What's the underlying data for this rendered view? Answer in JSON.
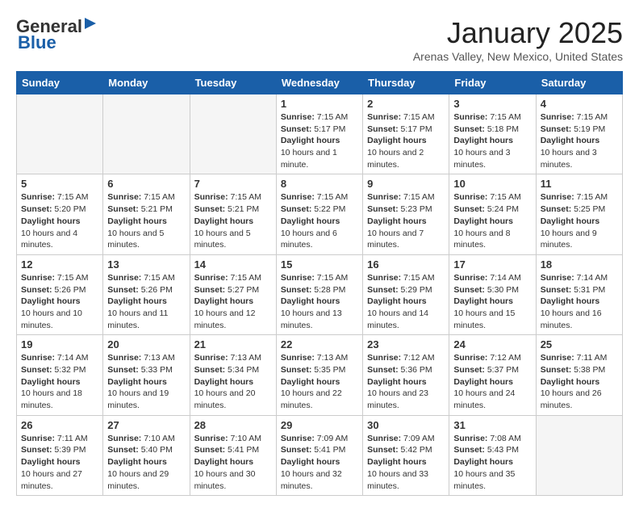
{
  "header": {
    "logo_line1": "General",
    "logo_line2": "Blue",
    "month": "January 2025",
    "location": "Arenas Valley, New Mexico, United States"
  },
  "weekdays": [
    "Sunday",
    "Monday",
    "Tuesday",
    "Wednesday",
    "Thursday",
    "Friday",
    "Saturday"
  ],
  "weeks": [
    [
      {
        "day": "",
        "empty": true
      },
      {
        "day": "",
        "empty": true
      },
      {
        "day": "",
        "empty": true
      },
      {
        "day": "1",
        "sunrise": "7:15 AM",
        "sunset": "5:17 PM",
        "daylight": "10 hours and 1 minute."
      },
      {
        "day": "2",
        "sunrise": "7:15 AM",
        "sunset": "5:17 PM",
        "daylight": "10 hours and 2 minutes."
      },
      {
        "day": "3",
        "sunrise": "7:15 AM",
        "sunset": "5:18 PM",
        "daylight": "10 hours and 3 minutes."
      },
      {
        "day": "4",
        "sunrise": "7:15 AM",
        "sunset": "5:19 PM",
        "daylight": "10 hours and 3 minutes."
      }
    ],
    [
      {
        "day": "5",
        "sunrise": "7:15 AM",
        "sunset": "5:20 PM",
        "daylight": "10 hours and 4 minutes."
      },
      {
        "day": "6",
        "sunrise": "7:15 AM",
        "sunset": "5:21 PM",
        "daylight": "10 hours and 5 minutes."
      },
      {
        "day": "7",
        "sunrise": "7:15 AM",
        "sunset": "5:21 PM",
        "daylight": "10 hours and 5 minutes."
      },
      {
        "day": "8",
        "sunrise": "7:15 AM",
        "sunset": "5:22 PM",
        "daylight": "10 hours and 6 minutes."
      },
      {
        "day": "9",
        "sunrise": "7:15 AM",
        "sunset": "5:23 PM",
        "daylight": "10 hours and 7 minutes."
      },
      {
        "day": "10",
        "sunrise": "7:15 AM",
        "sunset": "5:24 PM",
        "daylight": "10 hours and 8 minutes."
      },
      {
        "day": "11",
        "sunrise": "7:15 AM",
        "sunset": "5:25 PM",
        "daylight": "10 hours and 9 minutes."
      }
    ],
    [
      {
        "day": "12",
        "sunrise": "7:15 AM",
        "sunset": "5:26 PM",
        "daylight": "10 hours and 10 minutes."
      },
      {
        "day": "13",
        "sunrise": "7:15 AM",
        "sunset": "5:26 PM",
        "daylight": "10 hours and 11 minutes."
      },
      {
        "day": "14",
        "sunrise": "7:15 AM",
        "sunset": "5:27 PM",
        "daylight": "10 hours and 12 minutes."
      },
      {
        "day": "15",
        "sunrise": "7:15 AM",
        "sunset": "5:28 PM",
        "daylight": "10 hours and 13 minutes."
      },
      {
        "day": "16",
        "sunrise": "7:15 AM",
        "sunset": "5:29 PM",
        "daylight": "10 hours and 14 minutes."
      },
      {
        "day": "17",
        "sunrise": "7:14 AM",
        "sunset": "5:30 PM",
        "daylight": "10 hours and 15 minutes."
      },
      {
        "day": "18",
        "sunrise": "7:14 AM",
        "sunset": "5:31 PM",
        "daylight": "10 hours and 16 minutes."
      }
    ],
    [
      {
        "day": "19",
        "sunrise": "7:14 AM",
        "sunset": "5:32 PM",
        "daylight": "10 hours and 18 minutes."
      },
      {
        "day": "20",
        "sunrise": "7:13 AM",
        "sunset": "5:33 PM",
        "daylight": "10 hours and 19 minutes."
      },
      {
        "day": "21",
        "sunrise": "7:13 AM",
        "sunset": "5:34 PM",
        "daylight": "10 hours and 20 minutes."
      },
      {
        "day": "22",
        "sunrise": "7:13 AM",
        "sunset": "5:35 PM",
        "daylight": "10 hours and 22 minutes."
      },
      {
        "day": "23",
        "sunrise": "7:12 AM",
        "sunset": "5:36 PM",
        "daylight": "10 hours and 23 minutes."
      },
      {
        "day": "24",
        "sunrise": "7:12 AM",
        "sunset": "5:37 PM",
        "daylight": "10 hours and 24 minutes."
      },
      {
        "day": "25",
        "sunrise": "7:11 AM",
        "sunset": "5:38 PM",
        "daylight": "10 hours and 26 minutes."
      }
    ],
    [
      {
        "day": "26",
        "sunrise": "7:11 AM",
        "sunset": "5:39 PM",
        "daylight": "10 hours and 27 minutes."
      },
      {
        "day": "27",
        "sunrise": "7:10 AM",
        "sunset": "5:40 PM",
        "daylight": "10 hours and 29 minutes."
      },
      {
        "day": "28",
        "sunrise": "7:10 AM",
        "sunset": "5:41 PM",
        "daylight": "10 hours and 30 minutes."
      },
      {
        "day": "29",
        "sunrise": "7:09 AM",
        "sunset": "5:41 PM",
        "daylight": "10 hours and 32 minutes."
      },
      {
        "day": "30",
        "sunrise": "7:09 AM",
        "sunset": "5:42 PM",
        "daylight": "10 hours and 33 minutes."
      },
      {
        "day": "31",
        "sunrise": "7:08 AM",
        "sunset": "5:43 PM",
        "daylight": "10 hours and 35 minutes."
      },
      {
        "day": "",
        "empty": true
      }
    ]
  ],
  "labels": {
    "sunrise": "Sunrise:",
    "sunset": "Sunset:",
    "daylight": "Daylight:"
  }
}
